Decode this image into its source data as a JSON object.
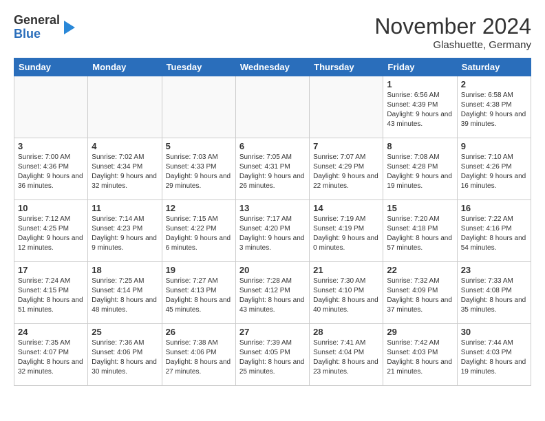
{
  "header": {
    "logo": {
      "general": "General",
      "blue": "Blue"
    },
    "title": "November 2024",
    "location": "Glashuette, Germany"
  },
  "days_of_week": [
    "Sunday",
    "Monday",
    "Tuesday",
    "Wednesday",
    "Thursday",
    "Friday",
    "Saturday"
  ],
  "weeks": [
    [
      {
        "day": "",
        "info": ""
      },
      {
        "day": "",
        "info": ""
      },
      {
        "day": "",
        "info": ""
      },
      {
        "day": "",
        "info": ""
      },
      {
        "day": "",
        "info": ""
      },
      {
        "day": "1",
        "info": "Sunrise: 6:56 AM\nSunset: 4:39 PM\nDaylight: 9 hours and 43 minutes."
      },
      {
        "day": "2",
        "info": "Sunrise: 6:58 AM\nSunset: 4:38 PM\nDaylight: 9 hours and 39 minutes."
      }
    ],
    [
      {
        "day": "3",
        "info": "Sunrise: 7:00 AM\nSunset: 4:36 PM\nDaylight: 9 hours and 36 minutes."
      },
      {
        "day": "4",
        "info": "Sunrise: 7:02 AM\nSunset: 4:34 PM\nDaylight: 9 hours and 32 minutes."
      },
      {
        "day": "5",
        "info": "Sunrise: 7:03 AM\nSunset: 4:33 PM\nDaylight: 9 hours and 29 minutes."
      },
      {
        "day": "6",
        "info": "Sunrise: 7:05 AM\nSunset: 4:31 PM\nDaylight: 9 hours and 26 minutes."
      },
      {
        "day": "7",
        "info": "Sunrise: 7:07 AM\nSunset: 4:29 PM\nDaylight: 9 hours and 22 minutes."
      },
      {
        "day": "8",
        "info": "Sunrise: 7:08 AM\nSunset: 4:28 PM\nDaylight: 9 hours and 19 minutes."
      },
      {
        "day": "9",
        "info": "Sunrise: 7:10 AM\nSunset: 4:26 PM\nDaylight: 9 hours and 16 minutes."
      }
    ],
    [
      {
        "day": "10",
        "info": "Sunrise: 7:12 AM\nSunset: 4:25 PM\nDaylight: 9 hours and 12 minutes."
      },
      {
        "day": "11",
        "info": "Sunrise: 7:14 AM\nSunset: 4:23 PM\nDaylight: 9 hours and 9 minutes."
      },
      {
        "day": "12",
        "info": "Sunrise: 7:15 AM\nSunset: 4:22 PM\nDaylight: 9 hours and 6 minutes."
      },
      {
        "day": "13",
        "info": "Sunrise: 7:17 AM\nSunset: 4:20 PM\nDaylight: 9 hours and 3 minutes."
      },
      {
        "day": "14",
        "info": "Sunrise: 7:19 AM\nSunset: 4:19 PM\nDaylight: 9 hours and 0 minutes."
      },
      {
        "day": "15",
        "info": "Sunrise: 7:20 AM\nSunset: 4:18 PM\nDaylight: 8 hours and 57 minutes."
      },
      {
        "day": "16",
        "info": "Sunrise: 7:22 AM\nSunset: 4:16 PM\nDaylight: 8 hours and 54 minutes."
      }
    ],
    [
      {
        "day": "17",
        "info": "Sunrise: 7:24 AM\nSunset: 4:15 PM\nDaylight: 8 hours and 51 minutes."
      },
      {
        "day": "18",
        "info": "Sunrise: 7:25 AM\nSunset: 4:14 PM\nDaylight: 8 hours and 48 minutes."
      },
      {
        "day": "19",
        "info": "Sunrise: 7:27 AM\nSunset: 4:13 PM\nDaylight: 8 hours and 45 minutes."
      },
      {
        "day": "20",
        "info": "Sunrise: 7:28 AM\nSunset: 4:12 PM\nDaylight: 8 hours and 43 minutes."
      },
      {
        "day": "21",
        "info": "Sunrise: 7:30 AM\nSunset: 4:10 PM\nDaylight: 8 hours and 40 minutes."
      },
      {
        "day": "22",
        "info": "Sunrise: 7:32 AM\nSunset: 4:09 PM\nDaylight: 8 hours and 37 minutes."
      },
      {
        "day": "23",
        "info": "Sunrise: 7:33 AM\nSunset: 4:08 PM\nDaylight: 8 hours and 35 minutes."
      }
    ],
    [
      {
        "day": "24",
        "info": "Sunrise: 7:35 AM\nSunset: 4:07 PM\nDaylight: 8 hours and 32 minutes."
      },
      {
        "day": "25",
        "info": "Sunrise: 7:36 AM\nSunset: 4:06 PM\nDaylight: 8 hours and 30 minutes."
      },
      {
        "day": "26",
        "info": "Sunrise: 7:38 AM\nSunset: 4:06 PM\nDaylight: 8 hours and 27 minutes."
      },
      {
        "day": "27",
        "info": "Sunrise: 7:39 AM\nSunset: 4:05 PM\nDaylight: 8 hours and 25 minutes."
      },
      {
        "day": "28",
        "info": "Sunrise: 7:41 AM\nSunset: 4:04 PM\nDaylight: 8 hours and 23 minutes."
      },
      {
        "day": "29",
        "info": "Sunrise: 7:42 AM\nSunset: 4:03 PM\nDaylight: 8 hours and 21 minutes."
      },
      {
        "day": "30",
        "info": "Sunrise: 7:44 AM\nSunset: 4:03 PM\nDaylight: 8 hours and 19 minutes."
      }
    ]
  ]
}
